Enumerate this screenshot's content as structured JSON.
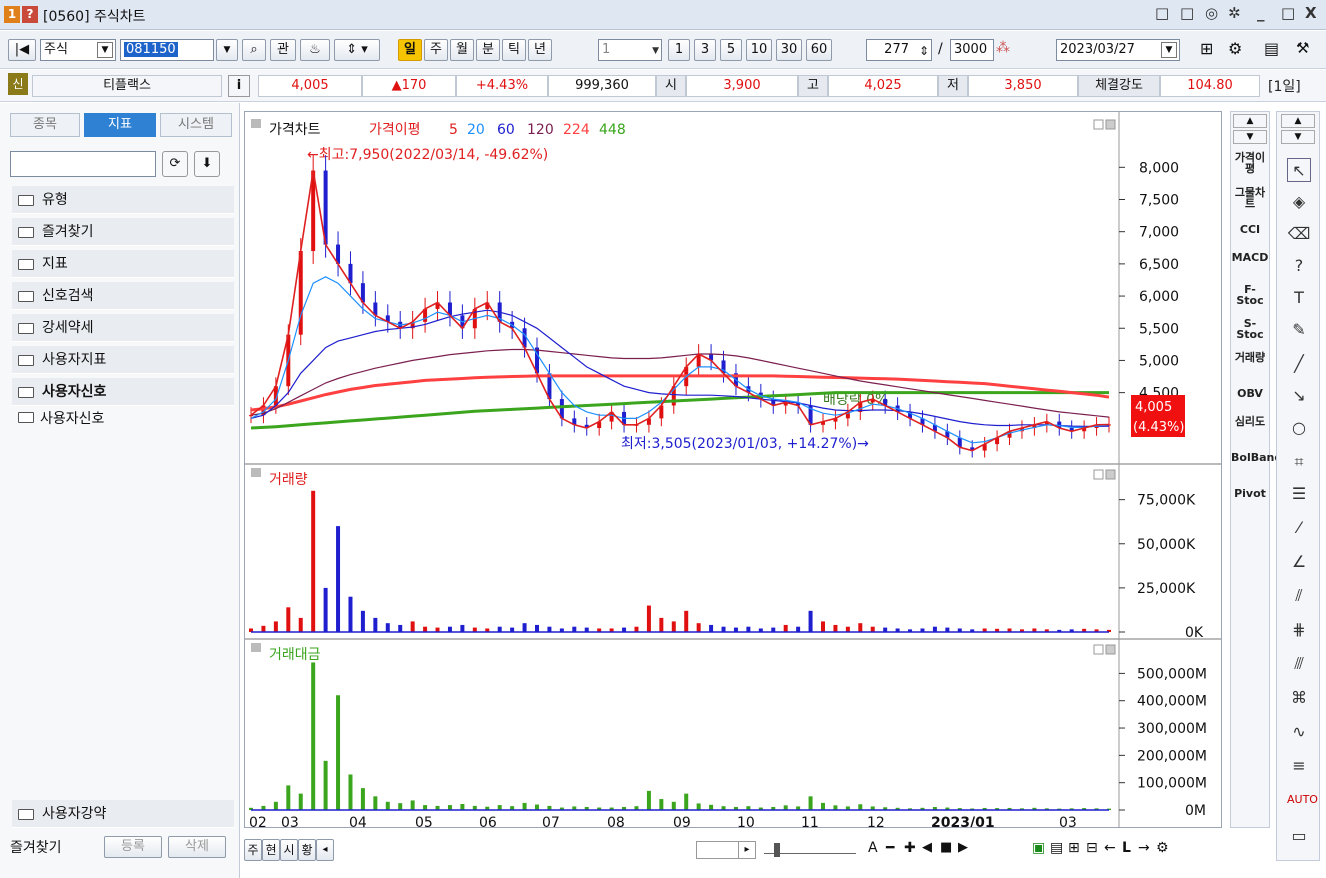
{
  "window": {
    "badge_num": "1",
    "badge_help": "?",
    "title": "[0560] 주식차트",
    "controls": [
      "□",
      "□",
      "◎",
      "✲",
      "_",
      "□",
      "X"
    ]
  },
  "toolbar": {
    "market": "주식",
    "code": "081150",
    "btn_gwan": "관",
    "period_buttons": [
      "일",
      "주",
      "월",
      "분",
      "틱",
      "년"
    ],
    "active_period": "일",
    "interval_value": "1",
    "interval_buttons": [
      "1",
      "3",
      "5",
      "10",
      "30",
      "60"
    ],
    "view_count": "277",
    "slash": "/",
    "total_count": "3000",
    "date": "2023/03/27"
  },
  "quote": {
    "new_badge": "신",
    "name": "티플랙스",
    "info_btn": "i",
    "price": "4,005",
    "change": "▲170",
    "change_pct": "+4.43%",
    "volume": "999,360",
    "open_label": "시",
    "open": "3,900",
    "high_label": "고",
    "high": "4,025",
    "low_label": "저",
    "low": "3,850",
    "strength_label": "체결강도",
    "strength": "104.80",
    "period_tag": "[1일]"
  },
  "left_panel": {
    "tabs": [
      "종목",
      "지표",
      "시스템"
    ],
    "active_tab": "지표",
    "folders": [
      "유형",
      "즐겨찾기",
      "지표",
      "신호검색",
      "강세약세",
      "사용자지표",
      "사용자신호"
    ],
    "subitem": "사용자신호",
    "bottom_folder": "사용자강약",
    "bottom_buttons": [
      "즐겨찾기",
      "등록",
      "삭제"
    ]
  },
  "chart_data": [
    {
      "type": "line",
      "title": "가격차트",
      "legend": [
        {
          "label": "가격차트",
          "color": "#111111"
        },
        {
          "label": "가격이평",
          "color": "#e02020"
        },
        {
          "label": "5",
          "color": "#e02020"
        },
        {
          "label": "20",
          "color": "#1e90ff"
        },
        {
          "label": "60",
          "color": "#1f1fcf"
        },
        {
          "label": "120",
          "color": "#7b1f4f"
        },
        {
          "label": "224",
          "color": "#ff4040"
        },
        {
          "label": "448",
          "color": "#3aa51d"
        }
      ],
      "y_ticks": [
        "8,000",
        "7,500",
        "7,000",
        "6,500",
        "6,000",
        "5,500",
        "5,000",
        "4,500"
      ],
      "ylim": [
        3500,
        8300
      ],
      "price_label": "4,005",
      "price_pct_label": "(4.43%)",
      "high_annotation": "←최고:7,950(2022/03/14, -49.62%)",
      "low_annotation": "최저:3,505(2023/01/03, +14.27%)→",
      "event_annotation": "배당락 0%",
      "x_labels": [
        "02",
        "03",
        "04",
        "05",
        "06",
        "07",
        "08",
        "09",
        "10",
        "11",
        "12",
        "2023/01",
        "03"
      ],
      "close": [
        4150,
        4300,
        4600,
        5400,
        6700,
        7950,
        6800,
        6500,
        6200,
        5900,
        5700,
        5600,
        5500,
        5600,
        5800,
        5900,
        5700,
        5500,
        5800,
        5900,
        5600,
        5500,
        5200,
        4800,
        4400,
        4100,
        4000,
        3950,
        4050,
        4200,
        4000,
        4000,
        4100,
        4300,
        4600,
        4900,
        5100,
        5000,
        4800,
        4600,
        4500,
        4400,
        4300,
        4350,
        4300,
        4000,
        4050,
        4100,
        4200,
        4350,
        4400,
        4300,
        4200,
        4100,
        4000,
        3900,
        3800,
        3650,
        3600,
        3700,
        3800,
        3900,
        3950,
        4000,
        4050,
        3950,
        3900,
        3950,
        4000,
        4005
      ],
      "ma20": [
        4100,
        4200,
        4400,
        5000,
        5700,
        6200,
        6300,
        6200,
        6000,
        5800,
        5650,
        5600,
        5550,
        5580,
        5650,
        5750,
        5700,
        5600,
        5650,
        5700,
        5650,
        5550,
        5400,
        5100,
        4800,
        4500,
        4300,
        4200,
        4150,
        4150,
        4100,
        4100,
        4200,
        4350,
        4550,
        4750,
        4900,
        4900,
        4850,
        4700,
        4550,
        4450,
        4400,
        4380,
        4350,
        4250,
        4180,
        4150,
        4180,
        4250,
        4320,
        4300,
        4250,
        4180,
        4100,
        4000,
        3900,
        3800,
        3720,
        3740,
        3800,
        3870,
        3920,
        3960,
        4000,
        3990,
        3960,
        3960,
        3980,
        4000
      ],
      "ma60": [
        4100,
        4150,
        4300,
        4500,
        4800,
        5000,
        5200,
        5300,
        5350,
        5400,
        5450,
        5480,
        5500,
        5520,
        5560,
        5620,
        5680,
        5720,
        5750,
        5780,
        5750,
        5700,
        5600,
        5500,
        5350,
        5200,
        5050,
        4900,
        4800,
        4700,
        4600,
        4550,
        4500,
        4480,
        4470,
        4460,
        4460,
        4460,
        4450,
        4440,
        4420,
        4400,
        4380,
        4360,
        4340,
        4300,
        4260,
        4230,
        4220,
        4220,
        4230,
        4230,
        4220,
        4200,
        4170,
        4130,
        4090,
        4050,
        4020,
        4000,
        3990,
        3990,
        4000,
        4000,
        4000,
        3990,
        3980,
        3975,
        3975,
        3980
      ],
      "ma120": [
        4150,
        4180,
        4250,
        4350,
        4450,
        4550,
        4650,
        4720,
        4780,
        4830,
        4880,
        4920,
        4960,
        5000,
        5030,
        5060,
        5090,
        5110,
        5130,
        5150,
        5160,
        5170,
        5170,
        5160,
        5140,
        5120,
        5100,
        5080,
        5060,
        5040,
        5030,
        5030,
        5030,
        5040,
        5060,
        5080,
        5100,
        5100,
        5090,
        5070,
        5040,
        5000,
        4960,
        4920,
        4880,
        4840,
        4800,
        4760,
        4720,
        4680,
        4650,
        4620,
        4590,
        4560,
        4530,
        4500,
        4470,
        4440,
        4410,
        4380,
        4350,
        4320,
        4290,
        4260,
        4230,
        4200,
        4180,
        4160,
        4140,
        4120
      ],
      "ma224": [
        4230,
        4250,
        4280,
        4320,
        4370,
        4420,
        4470,
        4510,
        4550,
        4580,
        4610,
        4630,
        4650,
        4670,
        4690,
        4700,
        4710,
        4720,
        4730,
        4740,
        4745,
        4750,
        4755,
        4760,
        4760,
        4760,
        4760,
        4760,
        4760,
        4760,
        4760,
        4760,
        4760,
        4760,
        4760,
        4760,
        4760,
        4760,
        4760,
        4760,
        4760,
        4760,
        4760,
        4755,
        4750,
        4745,
        4740,
        4735,
        4730,
        4725,
        4720,
        4715,
        4710,
        4700,
        4690,
        4680,
        4670,
        4660,
        4650,
        4640,
        4620,
        4600,
        4580,
        4560,
        4540,
        4520,
        4500,
        4480,
        4460,
        4430
      ],
      "ma448": [
        3950,
        3960,
        3970,
        3985,
        4000,
        4015,
        4030,
        4045,
        4060,
        4075,
        4090,
        4105,
        4120,
        4135,
        4150,
        4165,
        4180,
        4195,
        4210,
        4220,
        4230,
        4240,
        4250,
        4260,
        4270,
        4280,
        4290,
        4300,
        4310,
        4320,
        4330,
        4340,
        4350,
        4360,
        4370,
        4380,
        4390,
        4400,
        4410,
        4420,
        4430,
        4440,
        4450,
        4460,
        4470,
        4480,
        4490,
        4500,
        4500,
        4500,
        4500,
        4500,
        4500,
        4500,
        4500,
        4500,
        4500,
        4500,
        4500,
        4500,
        4500,
        4500,
        4500,
        4500,
        4500,
        4500,
        4500,
        4500,
        4500,
        4500
      ]
    },
    {
      "type": "bar",
      "title": "거래량",
      "y_ticks": [
        "75,000K",
        "50,000K",
        "25,000K",
        "0K"
      ],
      "ylim": [
        0,
        85000
      ],
      "values": [
        2000,
        3500,
        6000,
        14000,
        8000,
        80000,
        25000,
        60000,
        20000,
        12000,
        8000,
        5000,
        4000,
        6000,
        3000,
        2500,
        3000,
        4000,
        2500,
        2000,
        3000,
        2500,
        5000,
        4000,
        3000,
        2000,
        3000,
        2500,
        2000,
        2000,
        2500,
        3000,
        15000,
        8000,
        6000,
        12000,
        5000,
        4000,
        3000,
        2500,
        3000,
        2000,
        2500,
        4000,
        3000,
        12000,
        6000,
        4000,
        3000,
        5000,
        3000,
        2500,
        2000,
        1500,
        2000,
        3000,
        2500,
        2000,
        1500,
        2000,
        1800,
        2000,
        1500,
        2000,
        1500,
        1200,
        1500,
        1800,
        1500,
        1200
      ]
    },
    {
      "type": "bar",
      "title": "거래대금",
      "y_ticks": [
        "500,000M",
        "400,000M",
        "300,000M",
        "200,000M",
        "100,000M",
        "0M"
      ],
      "ylim": [
        0,
        560000
      ],
      "values": [
        8000,
        15000,
        30000,
        90000,
        60000,
        540000,
        180000,
        420000,
        130000,
        80000,
        50000,
        30000,
        25000,
        35000,
        18000,
        15000,
        18000,
        22000,
        15000,
        12000,
        18000,
        14000,
        26000,
        20000,
        15000,
        9000,
        13000,
        11000,
        9000,
        9000,
        11000,
        14000,
        70000,
        40000,
        30000,
        60000,
        24000,
        19000,
        14000,
        11000,
        14000,
        9000,
        11000,
        17000,
        13000,
        50000,
        26000,
        17000,
        13000,
        21000,
        13000,
        10000,
        8000,
        6000,
        8000,
        11000,
        9000,
        7000,
        5500,
        7500,
        7000,
        7500,
        6000,
        8000,
        6000,
        5000,
        6000,
        7000,
        6000,
        5000
      ]
    }
  ],
  "indicators": [
    "가격이평",
    "그물차트",
    "CCI",
    "MACD",
    "F-Stoc",
    "S-Stoc",
    "거래량",
    "OBV",
    "심리도",
    "BolBand",
    "Pivot"
  ],
  "bottom_bar": {
    "left_buttons": [
      "주",
      "현",
      "시",
      "황"
    ],
    "letters": [
      "A"
    ]
  }
}
